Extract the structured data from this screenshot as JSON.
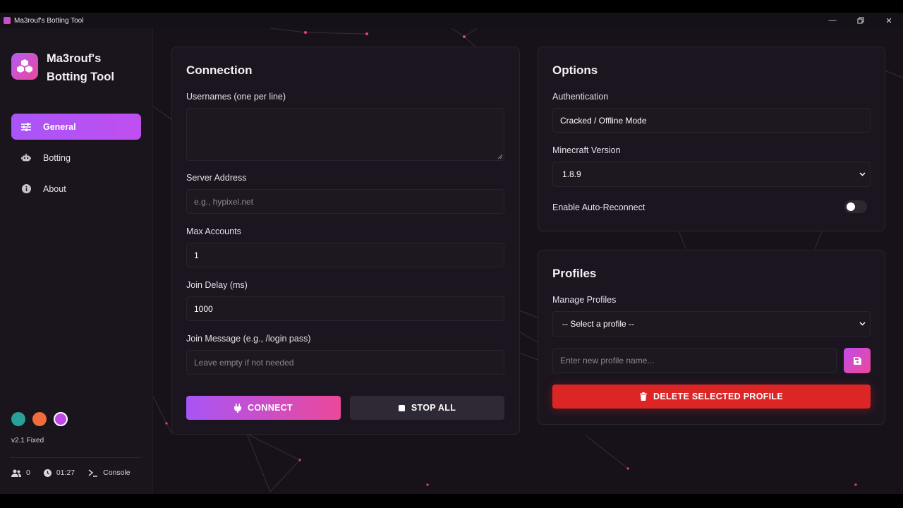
{
  "window": {
    "title": "Ma3rouf's Botting Tool"
  },
  "sidebar": {
    "brand_line1": "Ma3rouf's",
    "brand_line2": "Botting Tool",
    "nav": [
      {
        "label": "General",
        "icon": "sliders-icon",
        "active": true
      },
      {
        "label": "Botting",
        "icon": "robot-icon",
        "active": false
      },
      {
        "label": "About",
        "icon": "info-icon",
        "active": false
      }
    ],
    "themes": [
      "#2aa198",
      "#f26b3a",
      "#c148e8"
    ],
    "version": "v2.1 Fixed",
    "status": {
      "bots": "0",
      "uptime": "01:27",
      "console_label": "Console"
    }
  },
  "connection": {
    "title": "Connection",
    "usernames_label": "Usernames (one per line)",
    "usernames_value": "",
    "server_label": "Server Address",
    "server_placeholder": "e.g., hypixel.net",
    "max_label": "Max Accounts",
    "max_value": "1",
    "delay_label": "Join Delay (ms)",
    "delay_value": "1000",
    "message_label": "Join Message (e.g., /login pass)",
    "message_placeholder": "Leave empty if not needed",
    "connect_label": "CONNECT",
    "stop_label": "STOP ALL"
  },
  "options": {
    "title": "Options",
    "auth_label": "Authentication",
    "auth_value": "Cracked / Offline Mode",
    "version_label": "Minecraft Version",
    "version_value": "1.8.9",
    "reconnect_label": "Enable Auto-Reconnect",
    "reconnect_enabled": false
  },
  "profiles": {
    "title": "Profiles",
    "manage_label": "Manage Profiles",
    "select_value": "-- Select a profile --",
    "name_placeholder": "Enter new profile name...",
    "delete_label": "DELETE SELECTED PROFILE"
  },
  "colors": {
    "accent": "#a855f7",
    "accent2": "#ec4899",
    "danger": "#dc2626",
    "background": "#17121a"
  }
}
